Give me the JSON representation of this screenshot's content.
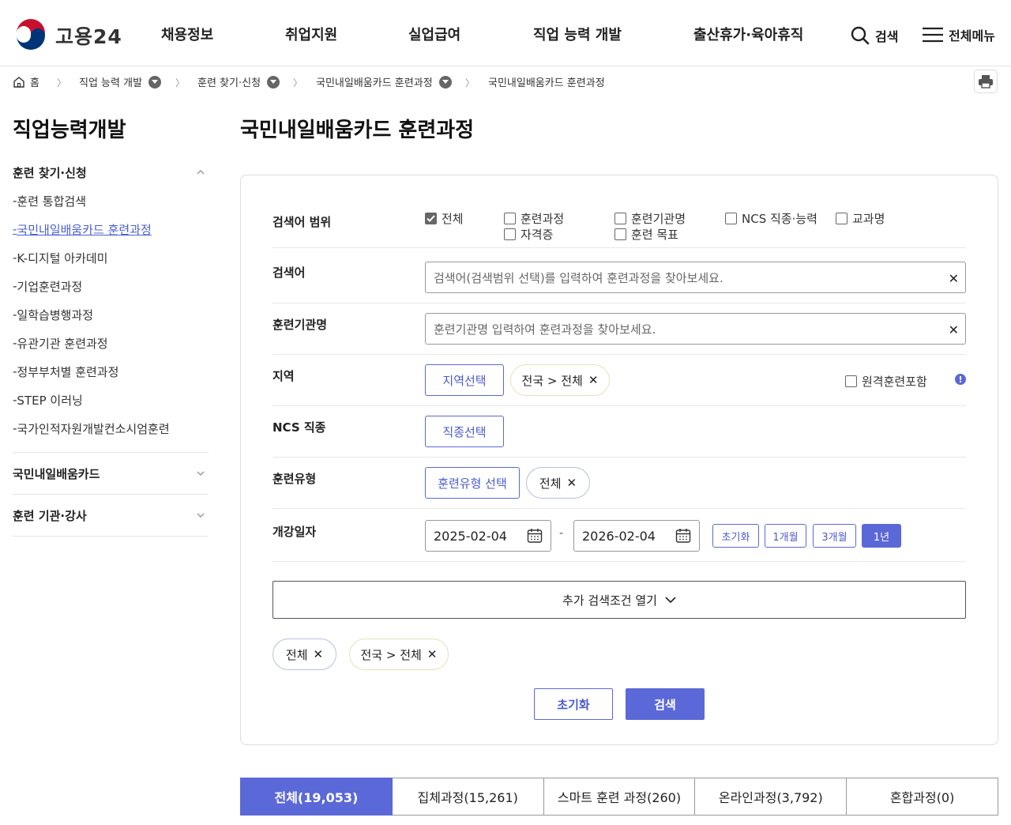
{
  "header": {
    "logo_text": "고용24",
    "nav": [
      "채용정보",
      "취업지원",
      "실업급여",
      "직업 능력 개발",
      "출산휴가·육아휴직"
    ],
    "search_label": "검색",
    "menu_label": "전체메뉴"
  },
  "breadcrumb": {
    "home": "홈",
    "items": [
      "직업 능력 개발",
      "훈련 찾기·신청",
      "국민내일배움카드 훈련과정",
      "국민내일배움카드 훈련과정"
    ]
  },
  "sidebar": {
    "title": "직업능력개발",
    "groups": [
      {
        "label": "훈련 찾기·신청",
        "items": [
          "훈련 통합검색",
          "국민내일배움카드 훈련과정",
          "K-디지털 아카데미",
          "기업훈련과정",
          "일학습병행과정",
          "유관기관 훈련과정",
          "정부부처별 훈련과정",
          "STEP 이러닝",
          "국가인적자원개발컨소시엄훈련"
        ]
      },
      {
        "label": "국민내일배움카드"
      },
      {
        "label": "훈련 기관·강사"
      }
    ]
  },
  "main": {
    "title": "국민내일배움카드 훈련과정",
    "scope": {
      "label": "검색어 범위",
      "options": [
        {
          "label": "전체",
          "checked": true
        },
        {
          "label": "훈련과정",
          "checked": false
        },
        {
          "label": "훈련기관명",
          "checked": false
        },
        {
          "label": "NCS 직종·능력",
          "checked": false
        },
        {
          "label": "교과명",
          "checked": false
        },
        {
          "label": "자격증",
          "checked": false
        },
        {
          "label": "훈련 목표",
          "checked": false
        }
      ]
    },
    "keyword": {
      "label": "검색어",
      "placeholder": "검색어(검색범위 선택)를 입력하여 훈련과정을 찾아보세요."
    },
    "institution": {
      "label": "훈련기관명",
      "placeholder": "훈련기관명 입력하여 훈련과정을 찾아보세요."
    },
    "region": {
      "label": "지역",
      "button": "지역선택",
      "chip": "전국 > 전체",
      "remote_label": "원격훈련포함"
    },
    "ncs": {
      "label": "NCS 직종",
      "button": "직종선택"
    },
    "train_type": {
      "label": "훈련유형",
      "button": "훈련유형 선택",
      "chip": "전체"
    },
    "open_date": {
      "label": "개강일자",
      "start": "2025-02-04",
      "separator": "-",
      "end": "2026-02-04",
      "periods": [
        {
          "label": "초기화",
          "active": false
        },
        {
          "label": "1개월",
          "active": false
        },
        {
          "label": "3개월",
          "active": false
        },
        {
          "label": "1년",
          "active": true
        }
      ]
    },
    "expand_label": "추가 검색조건 열기",
    "selected_chips": [
      "전체",
      "전국 > 전체"
    ],
    "reset_label": "초기화",
    "search_label": "검색"
  },
  "tabs": [
    {
      "label": "전체(19,053)",
      "active": true
    },
    {
      "label": "집체과정(15,261)",
      "active": false
    },
    {
      "label": "스마트 훈련 과정(260)",
      "active": false
    },
    {
      "label": "온라인과정(3,792)",
      "active": false
    },
    {
      "label": "혼합과정(0)",
      "active": false
    }
  ]
}
